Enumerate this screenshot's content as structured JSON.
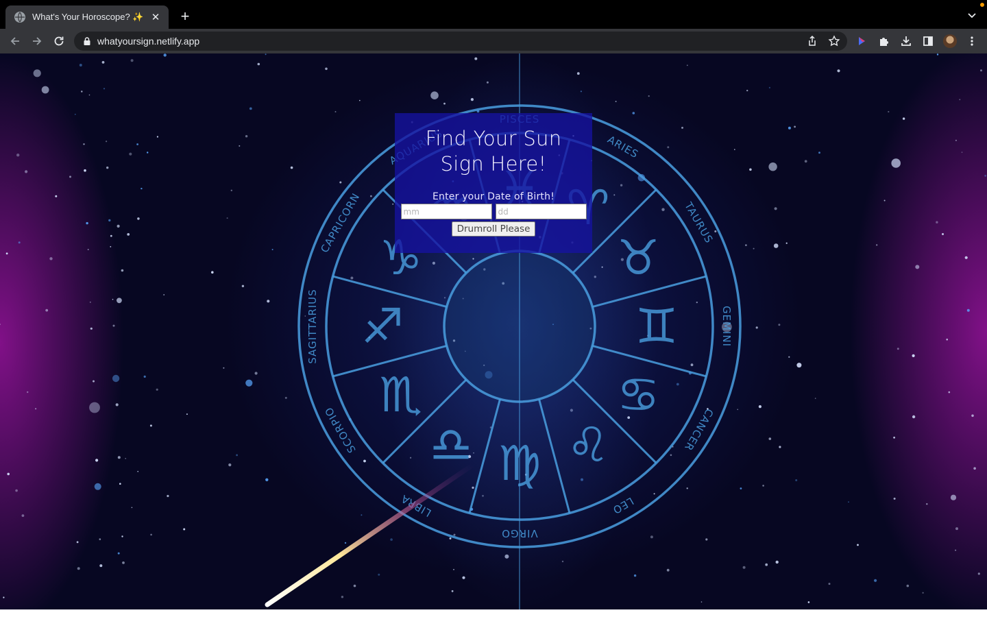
{
  "browser": {
    "tab": {
      "title": "What's Your Horoscope? ✨",
      "favicon": "globe-icon"
    },
    "new_tab_label": "+",
    "close_label": "✕",
    "url": "whatyoursign.netlify.app"
  },
  "colors": {
    "card_background": "#1612a0",
    "page_background": "#06061c",
    "nebula": "#aa14aa",
    "wheel_lines": "#4a9fe0"
  },
  "page": {
    "title": "Find Your Sun Sign Here!",
    "dob_label": "Enter your Date of Birth!",
    "month_placeholder": "mm",
    "day_placeholder": "dd",
    "submit_label": "Drumroll Please"
  },
  "zodiac_wheel": {
    "sign_names": [
      "PISCES",
      "ARIES",
      "TAURUS",
      "GEMINI",
      "CANCER",
      "LEO",
      "VIRGO",
      "LIBRA",
      "SCORPIO",
      "SAGITTARIUS",
      "CAPRICORN",
      "AQUARIUS"
    ],
    "glyphs": [
      "♓",
      "♈",
      "♉",
      "♊",
      "♋",
      "♌",
      "♍",
      "♎",
      "♏",
      "♐",
      "♑",
      "♒"
    ]
  }
}
